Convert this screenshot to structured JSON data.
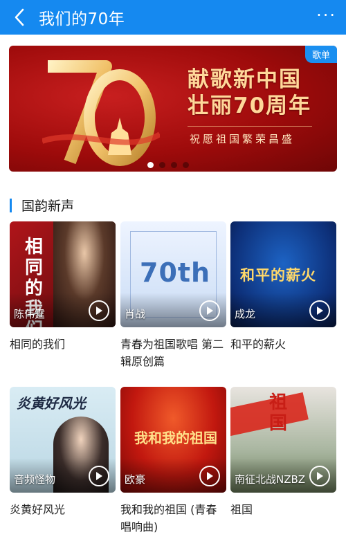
{
  "header": {
    "title": "我们的70年",
    "back_icon": "chevron-left-icon",
    "more_icon": "more-dots-icon",
    "bg_color": "#1589f0"
  },
  "banner": {
    "line1": "献歌新中国",
    "line2": "壮丽70周年",
    "subtitle": "祝愿祖国繁荣昌盛",
    "badge": "歌单",
    "slides_total": 4,
    "active_slide": 1
  },
  "section": {
    "title": "国韵新声",
    "accent_color": "#1589f0"
  },
  "cards": [
    {
      "name": "相同的我们",
      "artist": "陈伟霆",
      "cover_text": "相同的我们"
    },
    {
      "name": "青春为祖国歌唱 第二辑原创篇",
      "artist": "肖战",
      "cover_text": "70th"
    },
    {
      "name": "和平的薪火",
      "artist": "成龙",
      "cover_text": "和平的薪火"
    },
    {
      "name": "炎黄好风光",
      "artist": "音频怪物",
      "cover_text": "炎黄好风光"
    },
    {
      "name": "我和我的祖国 (青春唱响曲)",
      "artist": "欧豪",
      "cover_text": "我和我的祖国"
    },
    {
      "name": "祖国",
      "artist": "南征北战NZBZ",
      "cover_text": "祖国"
    }
  ]
}
